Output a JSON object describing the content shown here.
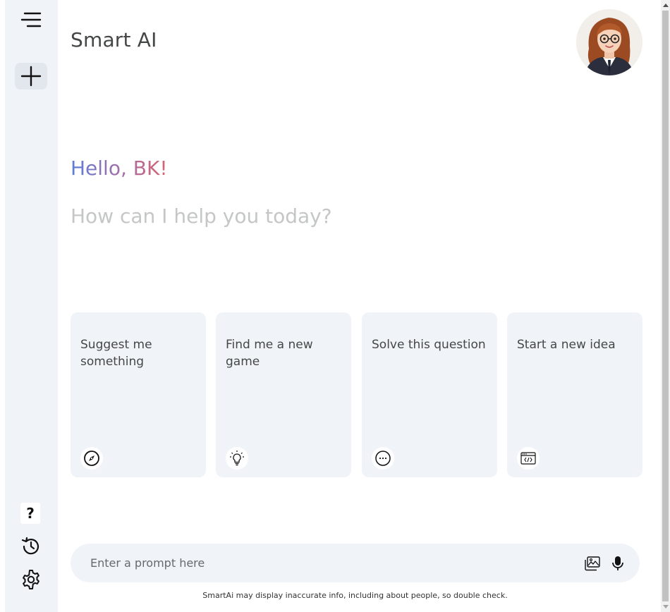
{
  "app": {
    "title": "Smart AI"
  },
  "greeting": {
    "hello": "Hello, BK!",
    "subtitle": "How can I help you today?"
  },
  "cards": [
    {
      "label": "Suggest me something",
      "icon": "compass-icon"
    },
    {
      "label": "Find me a new game",
      "icon": "lightbulb-icon"
    },
    {
      "label": "Solve this question",
      "icon": "chat-bubble-icon"
    },
    {
      "label": "Start a new idea",
      "icon": "code-window-icon"
    }
  ],
  "sidebar": {
    "menu_icon": "menu-icon",
    "new_chat_icon": "plus-icon",
    "help_label": "?",
    "history_icon": "history-icon",
    "settings_icon": "gear-icon"
  },
  "prompt": {
    "placeholder": "Enter a prompt here",
    "value": "",
    "gallery_icon": "image-icon",
    "mic_icon": "microphone-icon"
  },
  "disclaimer": "SmartAi may display inaccurate info, including about people, so double check.",
  "colors": {
    "sidebar_bg": "#f0f4f9",
    "card_bg": "#f0f4f9",
    "greeting_gradient_start": "#5b7fd8",
    "greeting_gradient_end": "#d9646f",
    "subtitle": "#c4c7c5"
  }
}
